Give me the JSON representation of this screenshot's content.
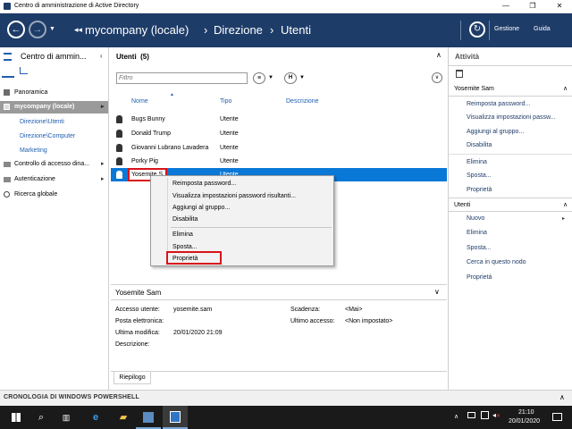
{
  "window": {
    "title": "Centro di amministrazione di Active Directory",
    "minimize": "—",
    "maximize": "❐",
    "close": "✕"
  },
  "navbar": {
    "breadcrumb": [
      "mycompany (locale)",
      "Direzione",
      "Utenti"
    ],
    "manage": "Gestione",
    "help": "Guida"
  },
  "leftnav": {
    "header": "Centro di ammin...",
    "items": [
      {
        "label": "Panoramica"
      },
      {
        "label": "mycompany (locale)"
      },
      {
        "label": "Direzione\\Utenti"
      },
      {
        "label": "Direzione\\Computer"
      },
      {
        "label": "Marketing"
      },
      {
        "label": "Controllo di accesso dina..."
      },
      {
        "label": "Autenticazione"
      },
      {
        "label": "Ricerca globale"
      }
    ]
  },
  "center": {
    "title": "Utenti  (5)",
    "filter_placeholder": "Filtro",
    "columns": [
      "Nome",
      "Tipo",
      "Descrizione"
    ],
    "rows": [
      {
        "name": "Bugs Bunny",
        "type": "Utente"
      },
      {
        "name": "Donald Trump",
        "type": "Utente"
      },
      {
        "name": "Giovanni Lubrano Lavadera",
        "type": "Utente"
      },
      {
        "name": "Porky Pig",
        "type": "Utente"
      },
      {
        "name": "Yosemite S",
        "type": "Utente"
      }
    ],
    "details": {
      "title": "Yosemite Sam",
      "access_label": "Accesso utente:",
      "access_value": "yosemite.sam",
      "email_label": "Posta elettronica:",
      "modified_label": "Ultima modifica:",
      "modified_value": "20/01/2020 21:09",
      "description_label": "Descrizione:",
      "expiry_label": "Scadenza:",
      "expiry_value": "<Mai>",
      "lastlogon_label": "Ultimo accesso:",
      "lastlogon_value": "<Non impostato>",
      "tab": "Riepilogo"
    }
  },
  "context_menu": {
    "items": [
      "Reimposta password...",
      "Visualizza impostazioni password risultanti...",
      "Aggiungi al gruppo...",
      "Disabilita",
      "Elimina",
      "Sposta...",
      "Proprietà"
    ]
  },
  "tasks": {
    "header": "Attività",
    "section1_title": "Yosemite Sam",
    "section1": [
      "Reimposta password...",
      "Visualizza impostazioni passw...",
      "Aggiungi al gruppo...",
      "Disabilita",
      "Elimina",
      "Sposta...",
      "Proprietà"
    ],
    "section2_title": "Utenti",
    "section2": [
      "Nuovo",
      "Elimina",
      "Sposta...",
      "Cerca in questo nodo",
      "Proprietà"
    ]
  },
  "powershell": {
    "label": "CRONOLOGIA DI WINDOWS POWERSHELL"
  },
  "taskbar": {
    "time": "21:10",
    "date": "20/01/2020"
  },
  "colors": {
    "navbar": "#1e3c68",
    "selection": "#0a78d7",
    "highlight": "#d8131b"
  }
}
